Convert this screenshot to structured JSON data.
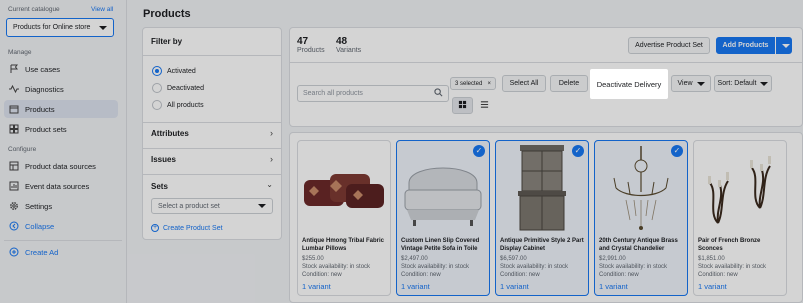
{
  "sidebar": {
    "current_catalogue_label": "Current catalogue",
    "view_all": "View all",
    "catalogue_value": "Products for Online store",
    "manage_label": "Manage",
    "configure_label": "Configure",
    "items": [
      {
        "label": "Use cases",
        "icon": "flag-icon"
      },
      {
        "label": "Diagnostics",
        "icon": "pulse-icon"
      },
      {
        "label": "Products",
        "icon": "box-icon",
        "active": true
      },
      {
        "label": "Product sets",
        "icon": "grid-icon"
      },
      {
        "label": "Product data sources",
        "icon": "database-icon"
      },
      {
        "label": "Event data sources",
        "icon": "events-icon"
      },
      {
        "label": "Settings",
        "icon": "gear-icon"
      }
    ],
    "collapse": "Collapse",
    "create_ad": "Create Ad"
  },
  "page": {
    "title": "Products"
  },
  "filter": {
    "heading": "Filter by",
    "options": [
      "Activated",
      "Deactivated",
      "All products"
    ],
    "selected_option": "Activated",
    "attributes": "Attributes",
    "issues": "Issues",
    "sets": "Sets",
    "set_placeholder": "Select a product set",
    "create_set": "Create Product Set"
  },
  "stats": {
    "products_count": "47",
    "products_label": "Products",
    "variants_count": "48",
    "variants_label": "Variants"
  },
  "toolbar": {
    "advertise": "Advertise Product Set",
    "add_products": "Add Products",
    "search_placeholder": "Search all products",
    "selected": "3 selected",
    "select_all": "Select All",
    "delete": "Delete",
    "deactivate_delivery": "Deactivate Delivery",
    "view": "View",
    "sort": "Sort: Default"
  },
  "products": [
    {
      "title": "Antique Hmong Tribal Fabric Lumbar Pillows",
      "price": "$255.00",
      "stock": "Stock availability: in stock",
      "condition": "Condition: new",
      "variants": "1 variant",
      "selected": false
    },
    {
      "title": "Custom Linen Slip Covered Vintage Petite Sofa in Toile",
      "price": "$2,497.00",
      "stock": "Stock availability: in stock",
      "condition": "Condition: new",
      "variants": "1 variant",
      "selected": true
    },
    {
      "title": "Antique Primitive Style 2 Part Display Cabinet",
      "price": "$6,597.00",
      "stock": "Stock availability: in stock",
      "condition": "Condition: new",
      "variants": "1 variant",
      "selected": true
    },
    {
      "title": "20th Century Antique Brass and Crystal Chandelier",
      "price": "$2,991.00",
      "stock": "Stock availability: in stock",
      "condition": "Condition: new",
      "variants": "1 variant",
      "selected": true
    },
    {
      "title": "Pair of French Bronze Sconces",
      "price": "$1,851.00",
      "stock": "Stock availability: in stock",
      "condition": "Condition: new",
      "variants": "1 variant",
      "selected": false
    }
  ],
  "colors": {
    "accent": "#1877f2",
    "background": "#f0f2f5"
  }
}
